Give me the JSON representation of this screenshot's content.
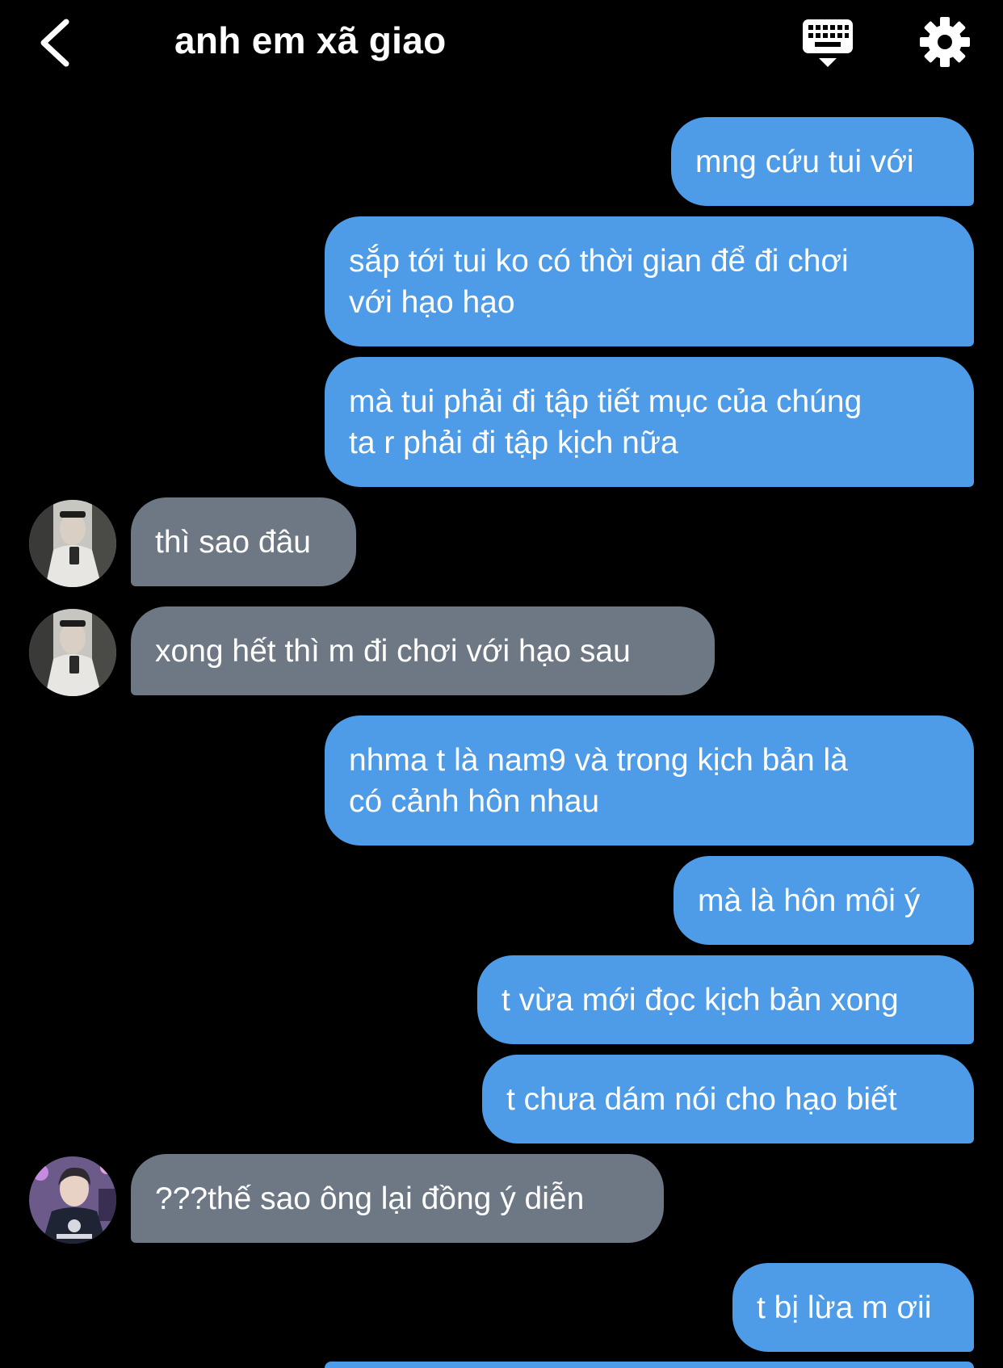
{
  "header": {
    "title": "anh em xã giao",
    "back_icon": "chevron-left-icon",
    "keyboard_icon": "keyboard-icon",
    "settings_icon": "gear-icon"
  },
  "colors": {
    "background": "#000000",
    "sent_bubble": "#4e9be7",
    "received_bubble": "#6e7884",
    "text": "#ffffff"
  },
  "messages": [
    {
      "side": "sent",
      "text": "mng cứu tui với"
    },
    {
      "side": "sent",
      "text": "sắp tới tui ko có thời gian để đi chơi\nvới hạo hạo"
    },
    {
      "side": "sent",
      "text": "mà tui phải đi tập tiết mục của chúng\nta r phải đi tập kịch nữa"
    },
    {
      "side": "received",
      "text": "thì sao đâu"
    },
    {
      "side": "received",
      "text": "xong hết thì m đi chơi với hạo sau"
    },
    {
      "side": "sent",
      "text": "nhma t là nam9 và trong kịch bản là\ncó cảnh hôn nhau"
    },
    {
      "side": "sent",
      "text": "mà là hôn môi ý"
    },
    {
      "side": "sent",
      "text": "t vừa mới đọc kịch bản xong"
    },
    {
      "side": "sent",
      "text": "t chưa dám nói cho hạo biết"
    },
    {
      "side": "received",
      "text": "???thế sao ông lại đồng ý diễn"
    },
    {
      "side": "sent",
      "text": "t bị lừa m ơii"
    }
  ]
}
